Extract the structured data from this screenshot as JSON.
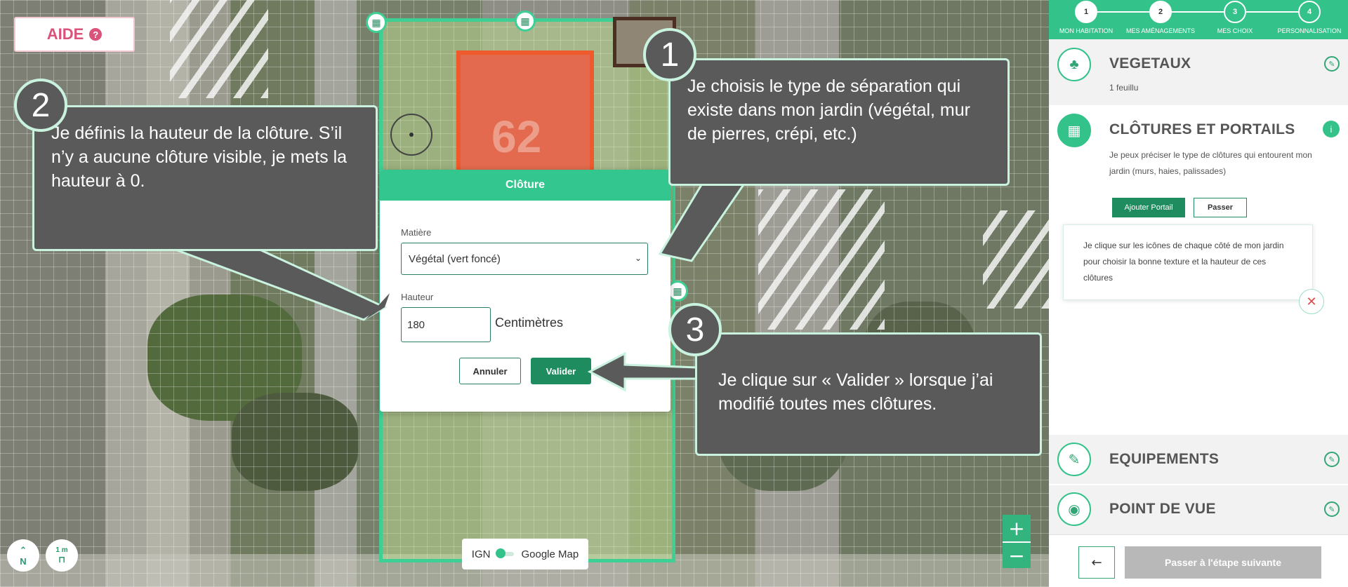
{
  "help": {
    "label": "AIDE",
    "icon": "question-icon"
  },
  "map": {
    "house_number": "62",
    "layer_toggle": {
      "left": "IGN",
      "right": "Google Map"
    },
    "scale": "1 m",
    "north": "N",
    "zoom_in": "+",
    "zoom_out": "−"
  },
  "modal": {
    "title": "Clôture",
    "material_label": "Matière",
    "material_value": "Végétal (vert foncé)",
    "height_label": "Hauteur",
    "height_value": "180",
    "unit": "Centimètres",
    "cancel_label": "Annuler",
    "confirm_label": "Valider"
  },
  "callouts": [
    {
      "number": "1",
      "text": "Je choisis le type de séparation qui existe dans mon jardin (végétal, mur de pierres, crépi, etc.)"
    },
    {
      "number": "2",
      "text": "Je définis la hauteur de la clôture. S’il n’y a aucune clôture visible, je mets la hauteur à 0."
    },
    {
      "number": "3",
      "text": "Je clique sur « Valider » lorsque j’ai modifié toutes mes clôtures."
    }
  ],
  "stepper": [
    {
      "num": "1",
      "label": "MON HABITATION"
    },
    {
      "num": "2",
      "label": "MES AMÉNAGEMENTS"
    },
    {
      "num": "3",
      "label": "MES CHOIX"
    },
    {
      "num": "4",
      "label": "PERSONNALISATION"
    }
  ],
  "sections": {
    "vegetaux": {
      "title": "VEGETAUX",
      "subtitle": "1 feuillu"
    },
    "clotures": {
      "title": "CLÔTURES ET PORTAILS",
      "description": "Je peux préciser le type de clôtures qui entourent mon jardin (murs, haies, palissades)",
      "add_gate": "Ajouter Portail",
      "skip": "Passer",
      "tip": "Je clique sur les icônes de chaque côté de mon jardin pour choisir la bonne texture et la hauteur de ces clôtures"
    },
    "equipements": {
      "title": "EQUIPEMENTS"
    },
    "point_de_vue": {
      "title": "POINT DE VUE"
    }
  },
  "footer": {
    "back": "←",
    "next": "Passer à l'étape suivante"
  },
  "colors": {
    "accent": "#33c28a",
    "dark_green": "#1e8c5e",
    "help_pink": "#d9537a",
    "callout_bg": "#5a5a5a"
  }
}
